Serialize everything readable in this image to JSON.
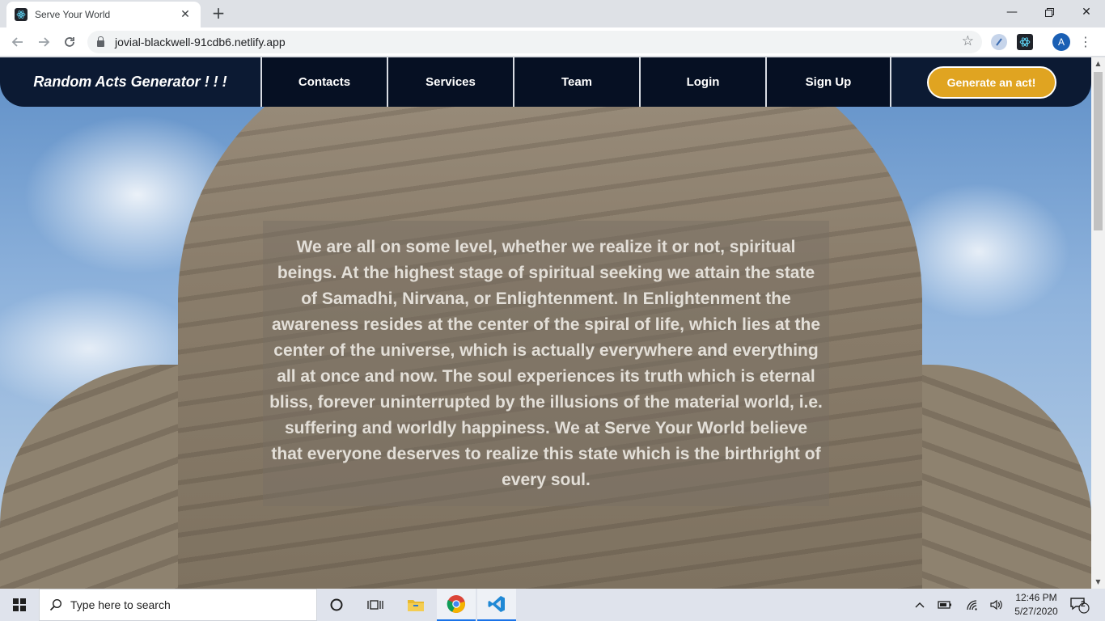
{
  "browser": {
    "tab_title": "Serve Your World",
    "url": "jovial-blackwell-91cdb6.netlify.app",
    "profile_initial": "A"
  },
  "site": {
    "brand": "Random Acts Generator ! ! !",
    "nav": [
      "Contacts",
      "Services",
      "Team",
      "Login",
      "Sign Up"
    ],
    "cta": "Generate an act!",
    "quote": "We are all on some level, whether we realize it or not, spiritual beings. At the highest stage of spiritual seeking we attain the state of Samadhi, Nirvana, or Enlightenment. In Enlightenment the awareness resides at the center of the spiral of life, which lies at the center of the universe, which is actually everywhere and everything all at once and now. The soul experiences its truth which is eternal bliss, forever uninterrupted by the illusions of the material world, i.e. suffering and worldly happiness. We at Serve Your World believe that everyone deserves to realize this state which is the birthright of every soul."
  },
  "taskbar": {
    "search_placeholder": "Type here to search",
    "time": "12:46 PM",
    "date": "5/27/2020",
    "notifications": "2"
  },
  "colors": {
    "nav_bg": "#0c1a33",
    "cta_bg": "#e0a421"
  }
}
